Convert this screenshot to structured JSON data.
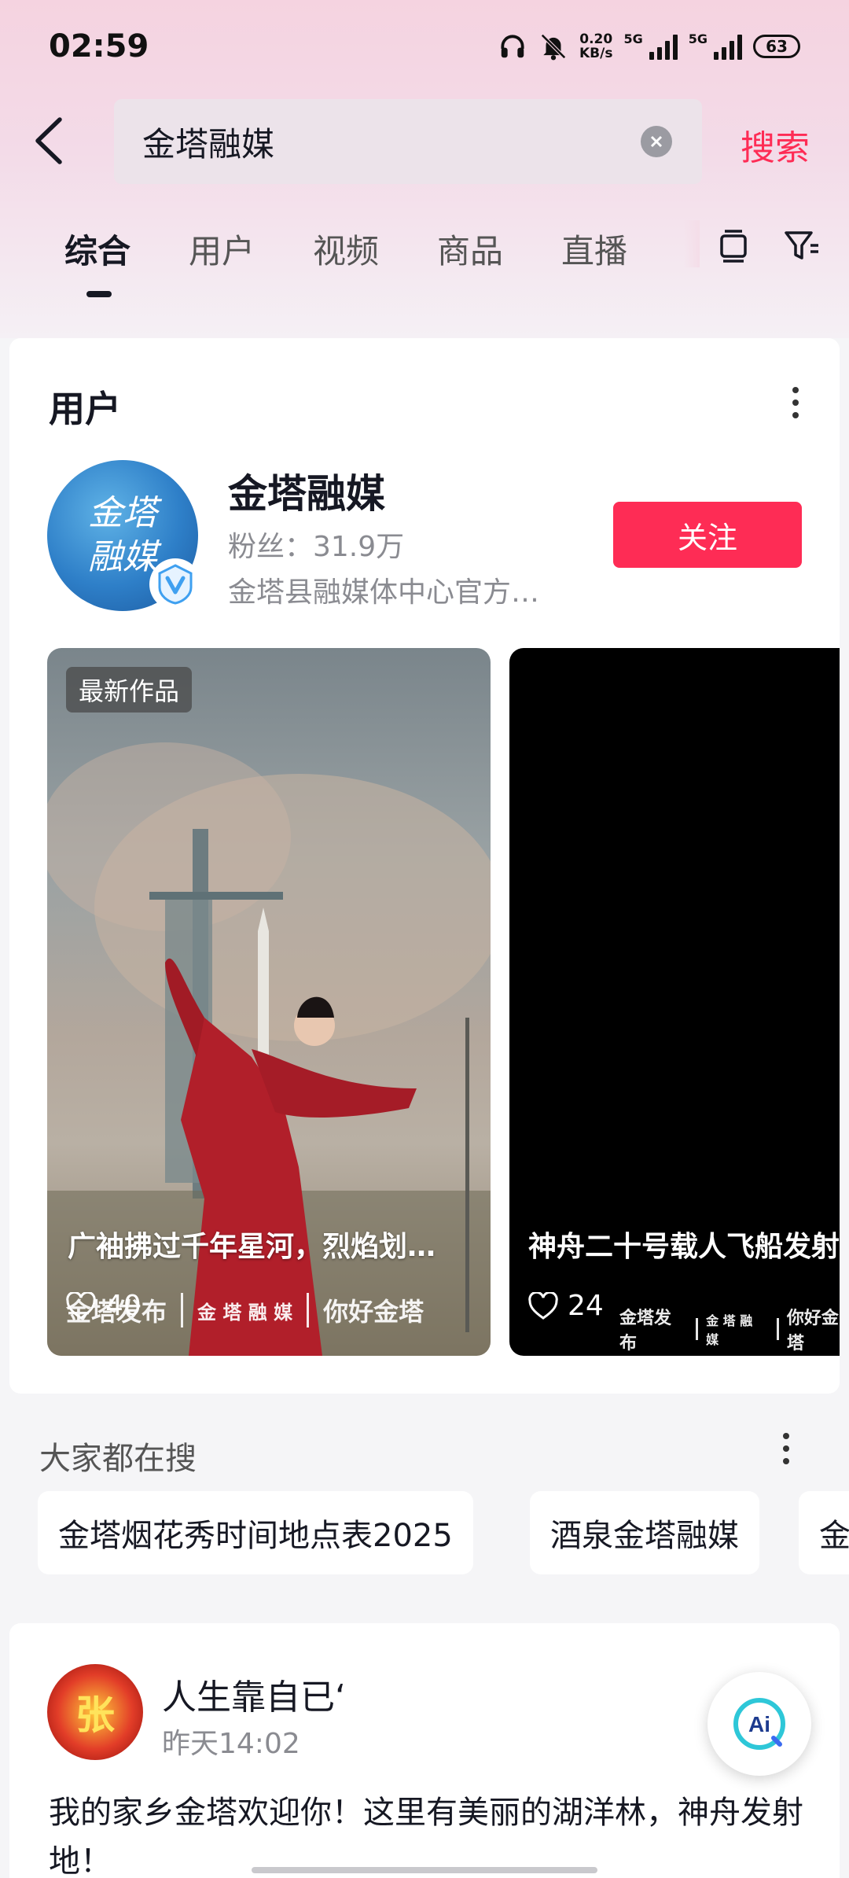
{
  "status_bar": {
    "time": "02:59",
    "net_speed_value": "0.20",
    "net_speed_unit": "KB/s",
    "sim1_label": "5G",
    "sim2_label": "5G",
    "battery": "63"
  },
  "search": {
    "query": "金塔融媒",
    "submit_label": "搜索"
  },
  "tabs": [
    {
      "label": "综合",
      "active": true
    },
    {
      "label": "用户"
    },
    {
      "label": "视频"
    },
    {
      "label": "商品"
    },
    {
      "label": "直播"
    }
  ],
  "user_section": {
    "title": "用户",
    "name": "金塔融媒",
    "fans": "粉丝：31.9万",
    "description": "金塔县融媒体中心官方…",
    "avatar_text_line1": "金塔",
    "avatar_text_line2": "融媒",
    "follow_label": "关注"
  },
  "videos": [
    {
      "badge": "最新作品",
      "caption": "广袖拂过千年星河，烈焰划…",
      "likes": "40",
      "watermark": [
        "金塔发布",
        "金 塔 融 媒",
        "你好金塔"
      ]
    },
    {
      "caption": "神舟二十号载人飞船发射",
      "likes": "24",
      "watermark": [
        "金塔发布",
        "金 塔 融 媒",
        "你好金塔"
      ]
    }
  ],
  "trending": {
    "title": "大家都在搜",
    "chips": [
      "金塔烟花秀时间地点表2025",
      "酒泉金塔融媒",
      "金"
    ]
  },
  "post": {
    "avatar_text": "张",
    "author": "人生靠自已‘",
    "time": "昨天14:02",
    "text": "我的家乡金塔欢迎你！这里有美丽的湖洋林，神舟发射地！"
  },
  "ai_button_label": "Ai",
  "colors": {
    "accent": "#fe2c55",
    "text_primary": "#161823",
    "text_secondary": "#8a8b91"
  }
}
